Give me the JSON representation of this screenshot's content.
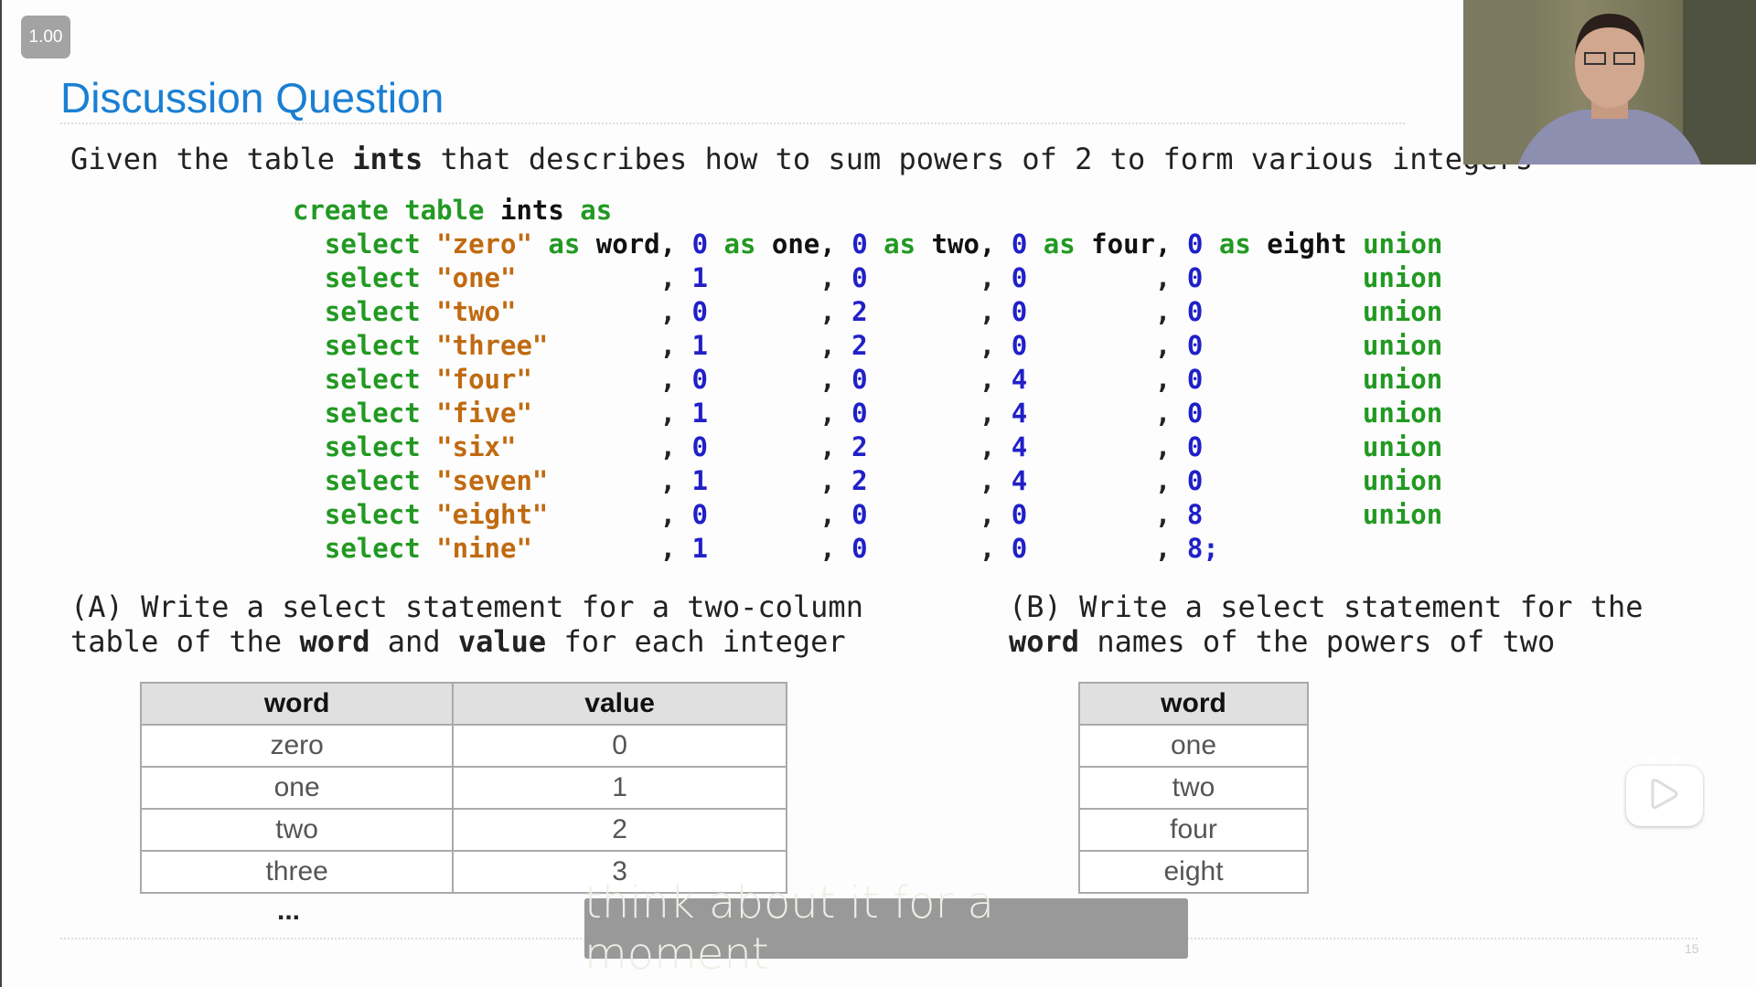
{
  "player": {
    "speed": "1.00",
    "subtitle": "think about it for a moment"
  },
  "slide": {
    "title": "Discussion Question",
    "given": [
      {
        "t": "Given the table ",
        "b": false
      },
      {
        "t": "ints",
        "b": true
      },
      {
        "t": " that describes how to sum powers of 2 to form various integers",
        "b": false
      }
    ],
    "code": {
      "header": [
        "create table",
        "ints",
        "as"
      ],
      "first_line": [
        "select",
        "\"zero\"",
        "as",
        "word,",
        "0",
        "as",
        "one,",
        "0",
        "as",
        "two,",
        "0",
        "as",
        "four,",
        "0",
        "as",
        "eight",
        "union"
      ],
      "rows": [
        {
          "word": "\"one\"",
          "vals": [
            "1",
            "0",
            "0",
            "0"
          ],
          "end": "union"
        },
        {
          "word": "\"two\"",
          "vals": [
            "0",
            "2",
            "0",
            "0"
          ],
          "end": "union"
        },
        {
          "word": "\"three\"",
          "vals": [
            "1",
            "2",
            "0",
            "0"
          ],
          "end": "union"
        },
        {
          "word": "\"four\"",
          "vals": [
            "0",
            "0",
            "4",
            "0"
          ],
          "end": "union"
        },
        {
          "word": "\"five\"",
          "vals": [
            "1",
            "0",
            "4",
            "0"
          ],
          "end": "union"
        },
        {
          "word": "\"six\"",
          "vals": [
            "0",
            "2",
            "4",
            "0"
          ],
          "end": "union"
        },
        {
          "word": "\"seven\"",
          "vals": [
            "1",
            "2",
            "4",
            "0"
          ],
          "end": "union"
        },
        {
          "word": "\"eight\"",
          "vals": [
            "0",
            "0",
            "0",
            "8"
          ],
          "end": "union"
        },
        {
          "word": "\"nine\"",
          "vals": [
            "1",
            "0",
            "0",
            "8;"
          ],
          "end": ""
        }
      ]
    },
    "question_a": [
      [
        {
          "t": "(A) Write a select statement for a two-column",
          "b": false
        }
      ],
      [
        {
          "t": "table of the ",
          "b": false
        },
        {
          "t": "word",
          "b": true
        },
        {
          "t": " and ",
          "b": false
        },
        {
          "t": "value",
          "b": true
        },
        {
          "t": " for each integer",
          "b": false
        }
      ]
    ],
    "question_b": [
      [
        {
          "t": "(B) Write a select statement for the",
          "b": false
        }
      ],
      [
        {
          "t": "word",
          "b": true
        },
        {
          "t": " names of the powers of two",
          "b": false
        }
      ]
    ],
    "table_a": {
      "headers": [
        "word",
        "value"
      ],
      "rows": [
        [
          "zero",
          "0"
        ],
        [
          "one",
          "1"
        ],
        [
          "two",
          "2"
        ],
        [
          "three",
          "3"
        ]
      ],
      "ellipsis": "..."
    },
    "table_b": {
      "headers": [
        "word"
      ],
      "rows": [
        [
          "one"
        ],
        [
          "two"
        ],
        [
          "four"
        ],
        [
          "eight"
        ]
      ]
    },
    "page_number": "15"
  },
  "colors": {
    "title": "#1a7fd4",
    "keyword": "#229922",
    "string": "#c06a10",
    "number": "#2020c8"
  }
}
